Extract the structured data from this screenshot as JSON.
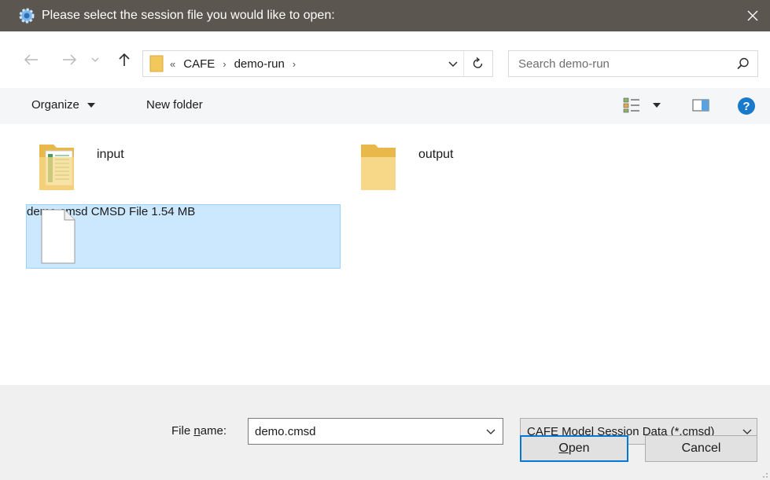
{
  "window": {
    "title": "Please select the session file you would like to open:"
  },
  "navigation": {
    "breadcrumb": [
      "CAFE",
      "demo-run"
    ],
    "overflow_marker": "«",
    "search_placeholder": "Search demo-run"
  },
  "toolbar": {
    "organize_label": "Organize",
    "new_folder_label": "New folder"
  },
  "items": [
    {
      "name": "input",
      "type": "folder"
    },
    {
      "name": "output",
      "type": "folder"
    },
    {
      "name": "demo.cmsd",
      "type_label": "CMSD File",
      "size": "1.54 MB",
      "selected": true
    }
  ],
  "bottom": {
    "file_name_label_prefix": "File ",
    "file_name_label_accel": "n",
    "file_name_label_suffix": "ame:",
    "file_name_value": "demo.cmsd",
    "file_type_value": "CAFE Model Session Data (*.cmsd)",
    "open_accel": "O",
    "open_rest": "pen",
    "cancel_label": "Cancel"
  },
  "colors": {
    "titlebar": "#5c5650",
    "selection": "#cce8ff",
    "selection_border": "#99d1ff",
    "accent": "#0078d7",
    "folder": "#f2c75c"
  },
  "icons": [
    "app-gear-icon",
    "close-icon",
    "back-arrow-icon",
    "forward-arrow-icon",
    "recent-dropdown-icon",
    "up-arrow-icon",
    "refresh-icon",
    "search-icon",
    "view-options-icon",
    "preview-pane-icon",
    "help-icon"
  ]
}
